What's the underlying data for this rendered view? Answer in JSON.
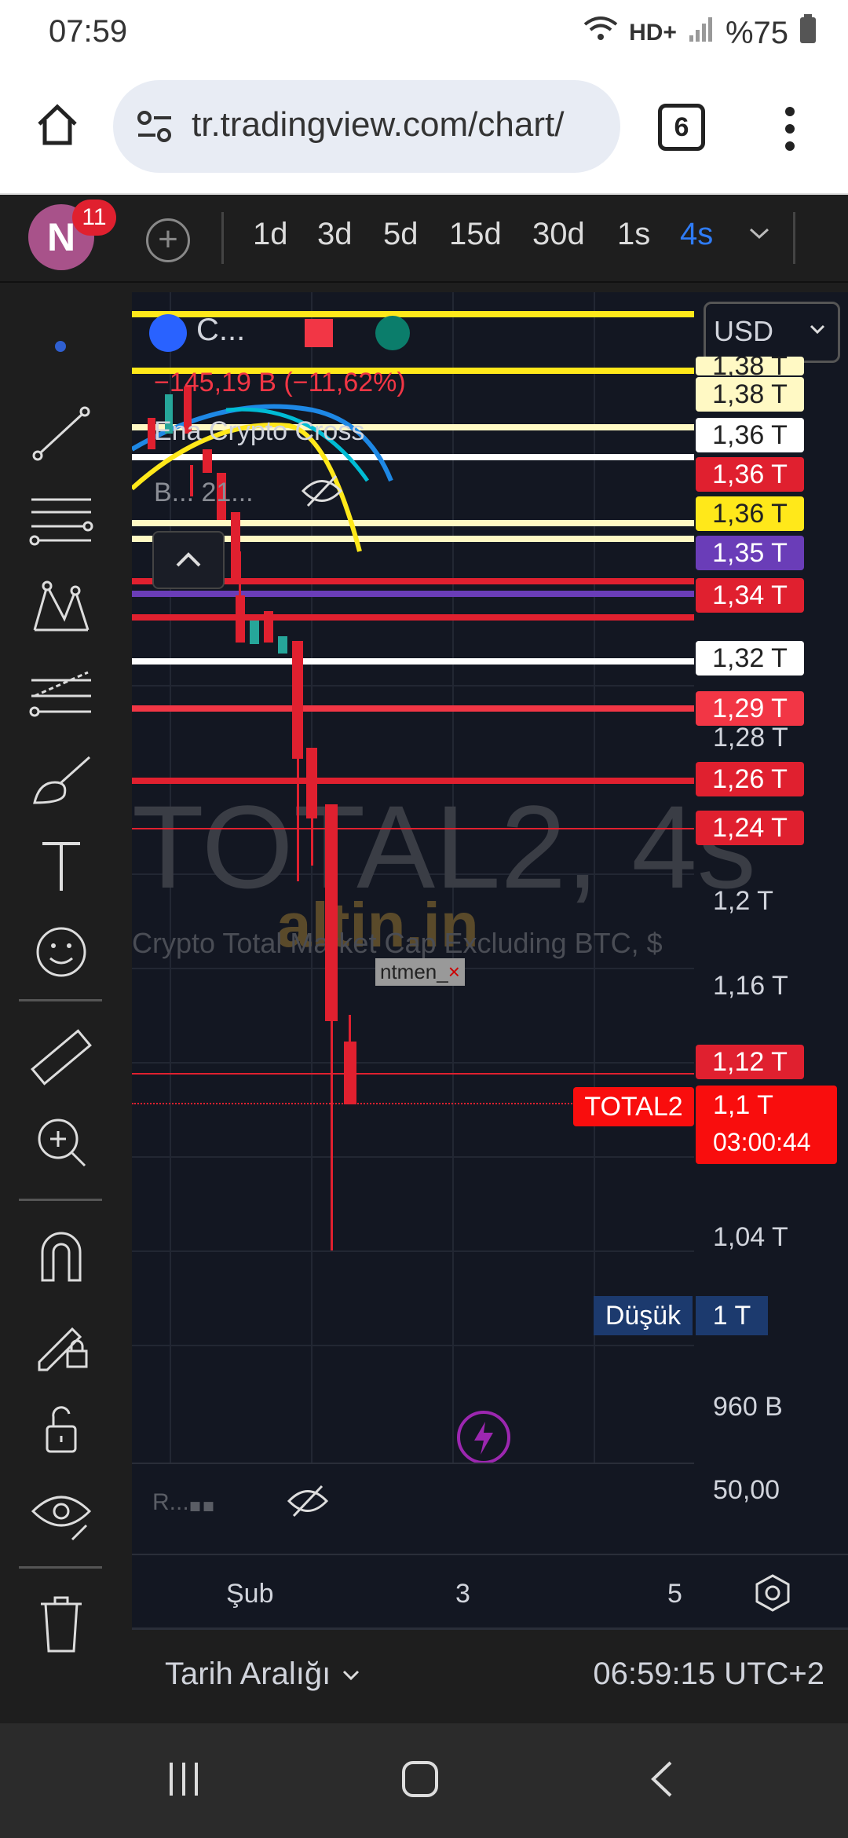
{
  "status": {
    "time": "07:59",
    "battery": "%75",
    "network": "HD+"
  },
  "browser": {
    "url": "tr.tradingview.com/chart/",
    "tabs": "6"
  },
  "toolbar": {
    "avatar_letter": "N",
    "notifications": "11",
    "timeframes": [
      "1d",
      "3d",
      "5d",
      "15d",
      "30d",
      "1s",
      "4s"
    ],
    "active_timeframe": "4s"
  },
  "chart": {
    "symbol_short": "C...",
    "change": "−145,19 B (−11,62%)",
    "indicator": "Ena Crypto Cross",
    "indicator2": "B... 21...",
    "currency": "USD",
    "watermark_title": "TOTAL2, 4s",
    "watermark_subtitle": "Crypto Total Market Cap Excluding BTC, $",
    "brand": "altin.in",
    "tooltip": "ntmen_",
    "symbol_tag": "TOTAL2",
    "current_price": "1,1 T",
    "countdown": "03:00:44",
    "low_label": "Düşük",
    "low_value": "1 T",
    "lower_pane_label": "R...",
    "lower_pane_value": "50,00",
    "price_tags": [
      {
        "text": "1,38 T",
        "bg": "#fff9c4",
        "fg": "#222"
      },
      {
        "text": "1,38 T",
        "bg": "#fff9c4",
        "fg": "#222"
      },
      {
        "text": "1,36 T",
        "bg": "#ffffff",
        "fg": "#222"
      },
      {
        "text": "1,36 T",
        "bg": "#e0202f",
        "fg": "#ffffff"
      },
      {
        "text": "1,36 T",
        "bg": "#ffe81a",
        "fg": "#222"
      },
      {
        "text": "1,35 T",
        "bg": "#6a3db8",
        "fg": "#ffffff"
      },
      {
        "text": "1,34 T",
        "bg": "#e0202f",
        "fg": "#ffffff"
      },
      {
        "text": "1,32 T",
        "bg": "#ffffff",
        "fg": "#222"
      },
      {
        "text": "1,29 T",
        "bg": "#f23645",
        "fg": "#ffffff"
      },
      {
        "text": "1,26 T",
        "bg": "#e0202f",
        "fg": "#ffffff"
      },
      {
        "text": "1,24 T",
        "bg": "#e0202f",
        "fg": "#ffffff"
      },
      {
        "text": "1,12 T",
        "bg": "#e0202f",
        "fg": "#ffffff"
      }
    ],
    "axis_labels": [
      "1,28 T",
      "1,2 T",
      "1,16 T",
      "1,04 T",
      "960 B"
    ],
    "x_labels": [
      "Şub",
      "3",
      "5"
    ]
  },
  "footer": {
    "date_range": "Tarih Aralığı",
    "clock": "06:59:15 UTC+2"
  }
}
